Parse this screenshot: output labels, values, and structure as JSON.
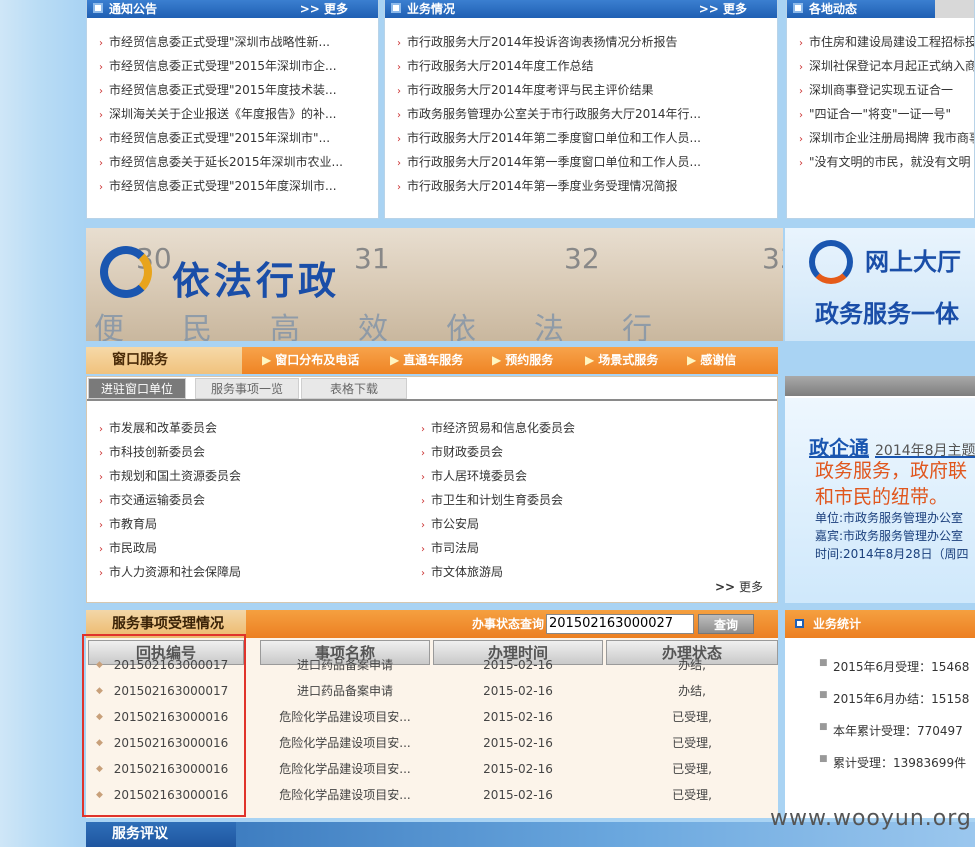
{
  "notice": {
    "title": "通知公告",
    "more": "更多",
    "items": [
      "市经贸信息委正式受理\"深圳市战略性新...",
      "市经贸信息委正式受理\"2015年深圳市企...",
      "市经贸信息委正式受理\"2015年度技术装...",
      "深圳海关关于企业报送《年度报告》的补...",
      "市经贸信息委正式受理\"2015年深圳市\"...",
      "市经贸信息委关于延长2015年深圳市农业...",
      "市经贸信息委正式受理\"2015年度深圳市..."
    ]
  },
  "business": {
    "title": "业务情况",
    "more": "更多",
    "items": [
      "市行政服务大厅2014年投诉咨询表扬情况分析报告",
      "市行政服务大厅2014年度工作总结",
      "市行政服务大厅2014年度考评与民主评价结果",
      "市政务服务管理办公室关于市行政服务大厅2014年行...",
      "市行政服务大厅2014年第二季度窗口单位和工作人员...",
      "市行政服务大厅2014年第一季度窗口单位和工作人员...",
      "市行政服务大厅2014年第一季度业务受理情况简报"
    ]
  },
  "local": {
    "title": "各地动态",
    "items": [
      "市住房和建设局建设工程招标投",
      "深圳社保登记本月起正式纳入商",
      "深圳商事登记实现五证合一",
      "\"四证合一\"将变\"一证一号\"",
      "深圳市企业注册局揭牌 我市商事",
      "\"没有文明的市民，就没有文明"
    ]
  },
  "banner": {
    "main": "依法行政",
    "slogan": "便民高效依法行政",
    "right_a": "网上大厅",
    "right_b": "政务服务一体"
  },
  "window_service": {
    "title": "窗口服务",
    "nav": [
      "窗口分布及电话",
      "直通车服务",
      "预约服务",
      "场景式服务",
      "感谢信"
    ],
    "tabs": [
      "进驻窗口单位",
      "服务事项一览",
      "表格下载"
    ],
    "depts_left": [
      "市发展和改革委员会",
      "市科技创新委员会",
      "市规划和国土资源委员会",
      "市交通运输委员会",
      "市教育局",
      "市民政局",
      "市人力资源和社会保障局"
    ],
    "depts_right": [
      "市经济贸易和信息化委员会",
      "市财政委员会",
      "市人居环境委员会",
      "市卫生和计划生育委员会",
      "市公安局",
      "市司法局",
      "市文体旅游局"
    ],
    "more": "更多"
  },
  "zhengqitong": {
    "title": "政企通",
    "date": "2014年8月主题",
    "line1": "政务服务，政府联",
    "line2": "和市民的纽带。",
    "unit": "单位:市政务服务管理办公室",
    "guest": "嘉宾:市政务服务管理办公室",
    "time": "时间:2014年8月28日（周四"
  },
  "service_status": {
    "title": "服务事项受理情况",
    "query_label": "办事状态查询",
    "query_value": "201502163000027",
    "query_button": "查询",
    "columns": [
      "回执编号",
      "事项名称",
      "办理时间",
      "办理状态"
    ],
    "rows": [
      [
        "201502163000017",
        "进口药品备案申请",
        "2015-02-16",
        "办结,"
      ],
      [
        "201502163000017",
        "进口药品备案申请",
        "2015-02-16",
        "办结,"
      ],
      [
        "201502163000016",
        "危险化学品建设项目安...",
        "2015-02-16",
        "已受理,"
      ],
      [
        "201502163000016",
        "危险化学品建设项目安...",
        "2015-02-16",
        "已受理,"
      ],
      [
        "201502163000016",
        "危险化学品建设项目安...",
        "2015-02-16",
        "已受理,"
      ],
      [
        "201502163000016",
        "危险化学品建设项目安...",
        "2015-02-16",
        "已受理,"
      ]
    ]
  },
  "stats": {
    "title": "业务统计",
    "items": [
      "2015年6月受理：15468",
      "2015年6月办结：15158",
      "本年累计受理：770497",
      "累计受理：13983699件"
    ]
  },
  "review": {
    "title": "服务评议"
  },
  "watermark": "www.wooyun.org"
}
